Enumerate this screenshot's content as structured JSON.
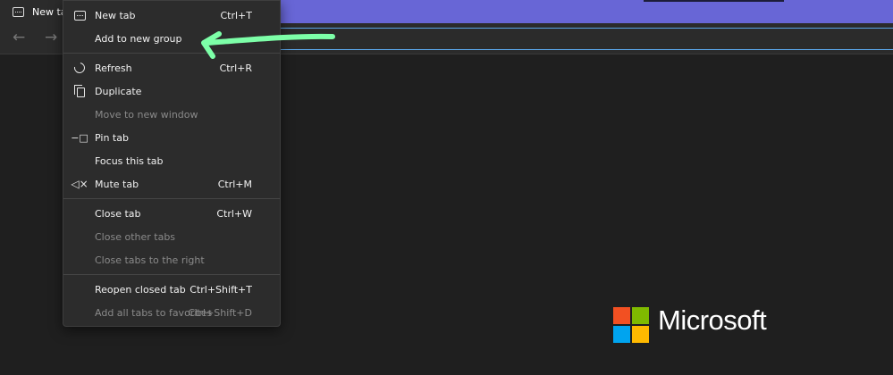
{
  "tab": {
    "title": "New tab",
    "icon": "newtab-icon"
  },
  "toolbar": {
    "back_icon": "arrow-left-icon",
    "forward_icon": "arrow-right-icon"
  },
  "menu": {
    "items": [
      {
        "label": "New tab",
        "shortcut": "Ctrl+T",
        "icon": "newtab-icon",
        "enabled": true
      },
      {
        "label": "Add to new group",
        "shortcut": "",
        "icon": "",
        "enabled": true
      },
      {
        "label": "Refresh",
        "shortcut": "Ctrl+R",
        "icon": "refresh-icon",
        "enabled": true
      },
      {
        "label": "Duplicate",
        "shortcut": "",
        "icon": "duplicate-icon",
        "enabled": true
      },
      {
        "label": "Move to new window",
        "shortcut": "",
        "icon": "",
        "enabled": false
      },
      {
        "label": "Pin tab",
        "shortcut": "",
        "icon": "pin-icon",
        "enabled": true
      },
      {
        "label": "Focus this tab",
        "shortcut": "",
        "icon": "",
        "enabled": true
      },
      {
        "label": "Mute tab",
        "shortcut": "Ctrl+M",
        "icon": "mute-icon",
        "enabled": true
      },
      {
        "label": "Close tab",
        "shortcut": "Ctrl+W",
        "icon": "",
        "enabled": true
      },
      {
        "label": "Close other tabs",
        "shortcut": "",
        "icon": "",
        "enabled": false
      },
      {
        "label": "Close tabs to the right",
        "shortcut": "",
        "icon": "",
        "enabled": false
      },
      {
        "label": "Reopen closed tab",
        "shortcut": "Ctrl+Shift+T",
        "icon": "",
        "enabled": true
      },
      {
        "label": "Add all tabs to favorites",
        "shortcut": "Ctrl+Shift+D",
        "icon": "",
        "enabled": false
      }
    ]
  },
  "branding": {
    "wordmark": "Microsoft",
    "logo_colors": [
      "#f25022",
      "#7fba00",
      "#00a4ef",
      "#ffb900"
    ]
  },
  "colors": {
    "tabstrip": "#6866d6",
    "annotation_arrow": "#7dffa8",
    "focus_outline": "#5aa4e6"
  }
}
